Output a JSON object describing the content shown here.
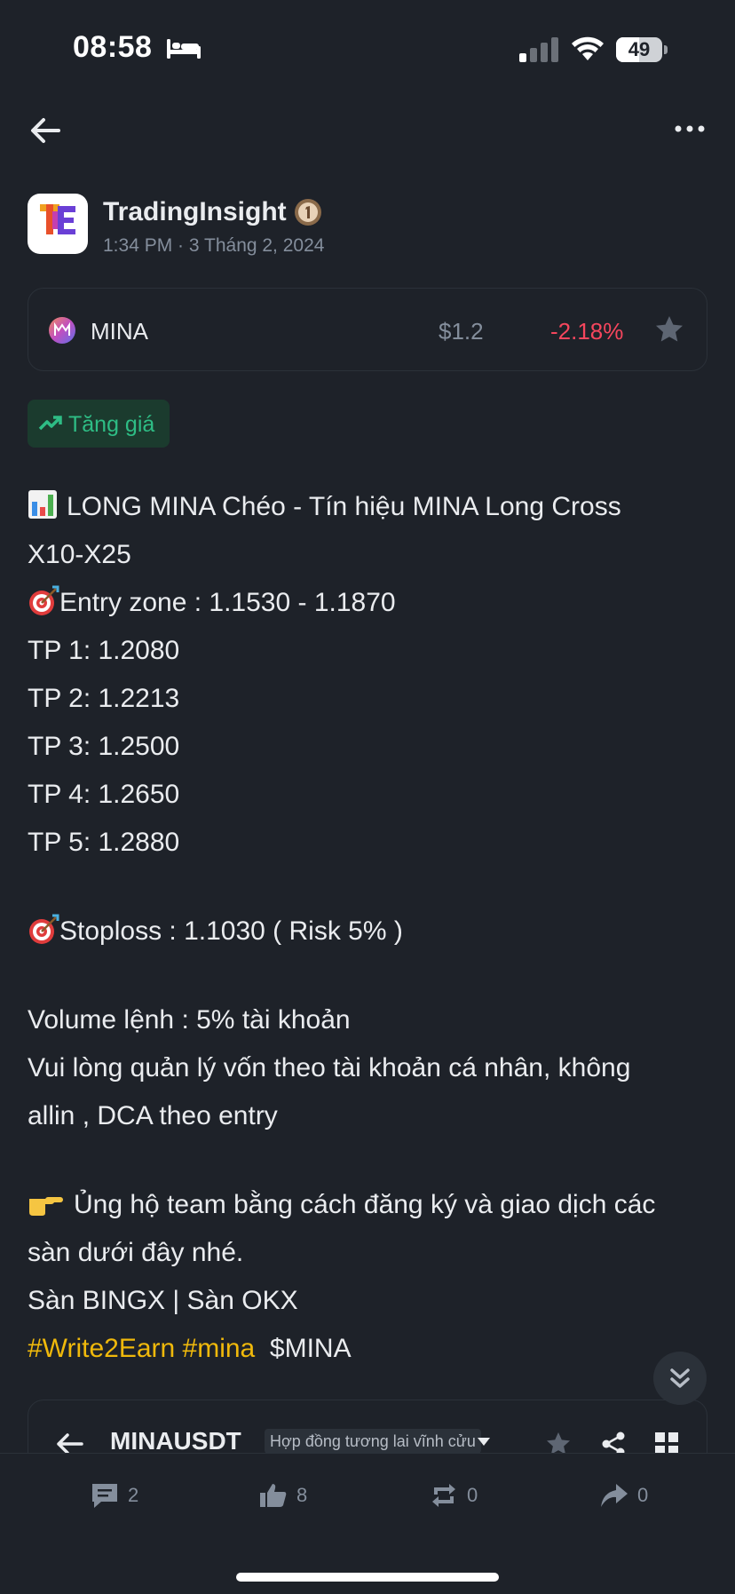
{
  "status_bar": {
    "time": "08:58",
    "battery": "49"
  },
  "author": {
    "name": "TradingInsight",
    "meta": "1:34 PM · 3 Tháng 2, 2024",
    "avatar_text": "TradingInsight"
  },
  "coin": {
    "symbol": "MINA",
    "price": "$1.2",
    "change": "-2.18%"
  },
  "sentiment": {
    "label": "Tăng giá",
    "color": "#2ebd85"
  },
  "post": {
    "title_line1": "LONG MINA Chéo - Tín hiệu MINA Long Cross",
    "title_line2": "X10-X25",
    "entry": "Entry zone  : 1.1530 - 1.1870",
    "tp1": "TP 1: 1.2080",
    "tp2": "TP 2: 1.2213",
    "tp3": "TP 3: 1.2500",
    "tp4": "TP 4: 1.2650",
    "tp5": "TP 5: 1.2880",
    "stoploss": "Stoploss : 1.1030 ( Risk 5% )",
    "volume": "Volume lệnh : 5% tài khoản",
    "advice_line1": "Vui lòng quản lý vốn theo tài khoản cá nhân, không",
    "advice_line2": "allin , DCA theo entry",
    "support_line1": "Ủng hộ team bằng cách đăng ký và giao dịch các",
    "support_line2": "sàn dưới đây nhé.",
    "exchanges": "Sàn BINGX | Sàn OKX",
    "hashtag1": "#Write2Earn",
    "hashtag2": "#mina",
    "cashtag": "$MINA"
  },
  "embed": {
    "symbol": "MINAUSDT",
    "contract_type": "Hợp đồng tương lai vĩnh cửu"
  },
  "actions": {
    "comments": "2",
    "likes": "8",
    "reposts": "0",
    "shares": "0"
  },
  "colors": {
    "background": "#1e2229",
    "accent": "#f0b90b",
    "negative": "#f6465d",
    "positive": "#2ebd85",
    "muted": "#848e9c"
  }
}
